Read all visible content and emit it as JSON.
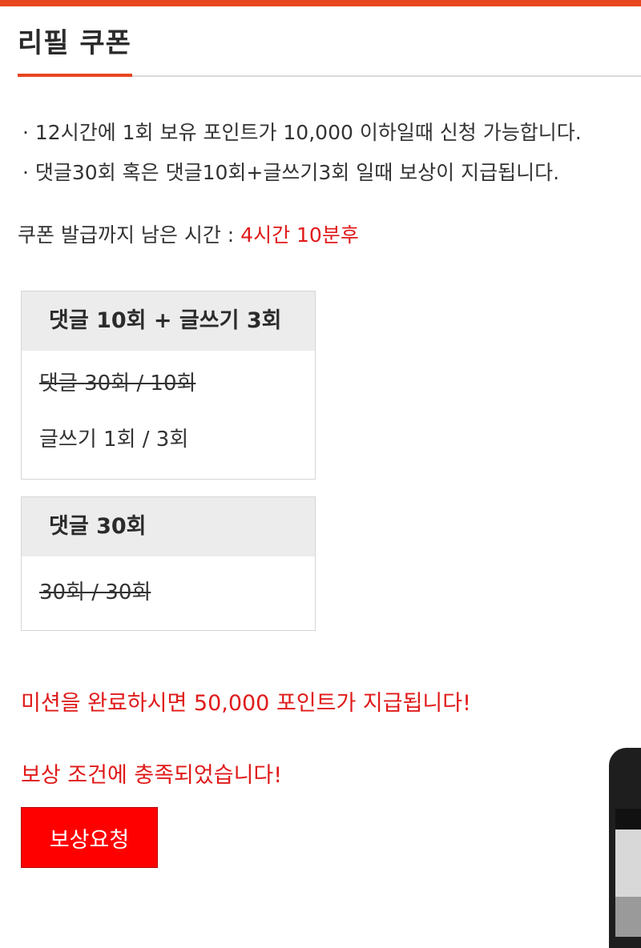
{
  "page": {
    "title": "리필 쿠폰"
  },
  "notices": [
    "· 12시간에 1회 보유 포인트가 10,000 이하일때 신청 가능합니다.",
    "· 댓글30회 혹은 댓글10회+글쓰기3회 일때 보상이 지급됩니다."
  ],
  "remaining": {
    "label": "쿠폰 발급까지 남은 시간 : ",
    "value": "4시간 10분후"
  },
  "mission_a": {
    "title": "댓글 10회 + 글쓰기 3회",
    "comment_progress": "댓글 30회 / 10회",
    "post_progress": "글쓰기 1회 / 3회"
  },
  "mission_b": {
    "title": "댓글 30회",
    "comment_progress": "30회 / 30회"
  },
  "messages": {
    "reward_info": "미션을 완료하시면 50,000 포인트가 지급됩니다!",
    "condition_met": "보상 조건에 충족되었습니다!"
  },
  "buttons": {
    "request_reward": "보상요청"
  },
  "colors": {
    "accent": "#e8461e",
    "alert_red": "#e01a1a",
    "button_red": "#ff0000",
    "box_header": "#ececec"
  }
}
